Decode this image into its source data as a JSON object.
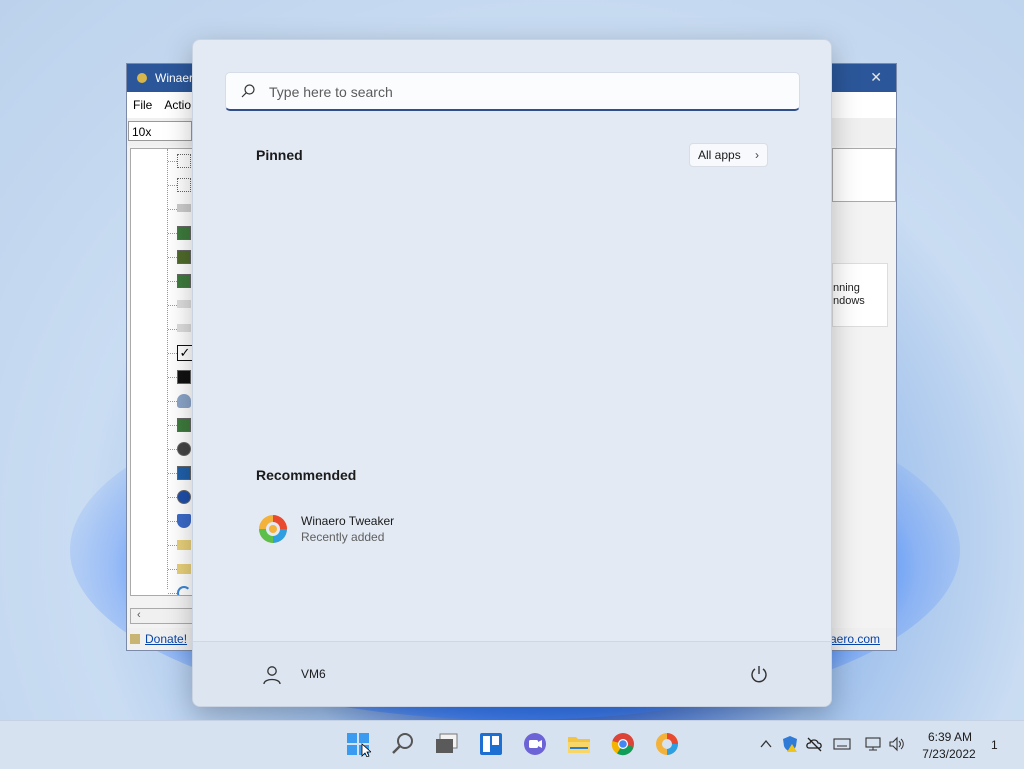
{
  "background_window": {
    "title": "Winaero",
    "menu": [
      "File",
      "Actio"
    ],
    "zoom_value": "10x",
    "status_link": "Donate!",
    "site_link": "aero.com",
    "card_text_1": "nning",
    "card_text_2": "ndows"
  },
  "start_menu": {
    "search_placeholder": "Type here to search",
    "pinned_title": "Pinned",
    "all_apps_label": "All apps",
    "recommended_title": "Recommended",
    "recommended": [
      {
        "name": "Winaero Tweaker",
        "subtitle": "Recently added",
        "icon": "winaero-tweaker-icon"
      }
    ],
    "user_name": "VM6"
  },
  "taskbar": {
    "icons": [
      "start-icon",
      "search-icon",
      "task-view-icon",
      "widgets-icon",
      "teams-chat-icon",
      "file-explorer-icon",
      "chrome-icon",
      "winaero-tweaker-icon"
    ],
    "tray_icons": [
      "chevron-up-icon",
      "defender-icon",
      "onedrive-icon",
      "keyboard-icon",
      "network-icon",
      "volume-icon"
    ],
    "time": "6:39 AM",
    "date": "7/23/2022",
    "notification_count": "1"
  }
}
